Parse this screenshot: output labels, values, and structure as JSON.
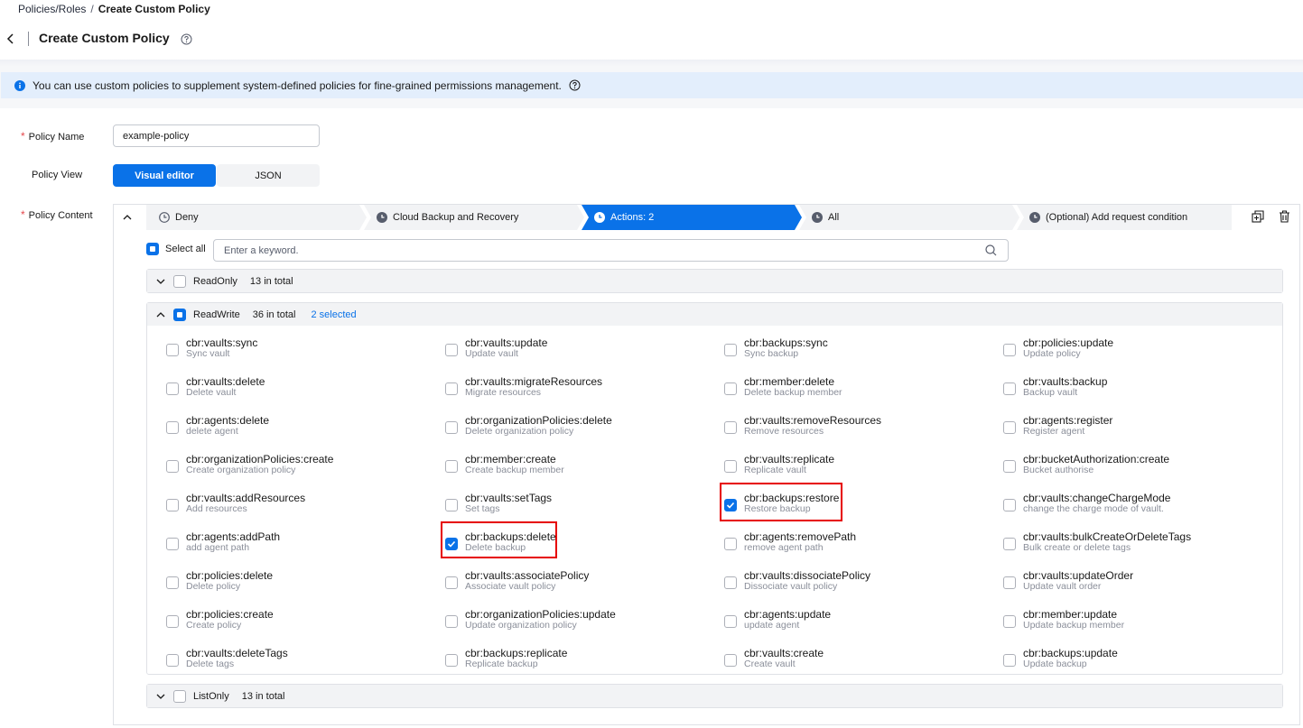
{
  "breadcrumb": {
    "parent": "Policies/Roles",
    "separator": "/",
    "current": "Create Custom Policy"
  },
  "page": {
    "title": "Create Custom Policy"
  },
  "info": {
    "text": "You can use custom policies to supplement system-defined policies for fine-grained permissions management."
  },
  "form": {
    "name_label": "Policy Name",
    "name_value": "example-policy",
    "view_label": "Policy View",
    "view_options": [
      "Visual editor",
      "JSON"
    ],
    "content_label": "Policy Content"
  },
  "steps": [
    "Deny",
    "Cloud Backup and Recovery",
    "Actions: 2",
    "All",
    "(Optional) Add request condition"
  ],
  "select_all_label": "Select all",
  "search_placeholder": "Enter a keyword.",
  "groups": {
    "readonly": {
      "name": "ReadOnly",
      "count": "13 in total"
    },
    "readwrite": {
      "name": "ReadWrite",
      "count": "36 in total",
      "selected": "2 selected"
    },
    "listonly": {
      "name": "ListOnly",
      "count": "13 in total"
    }
  },
  "actions": [
    [
      {
        "name": "cbr:vaults:sync",
        "desc": "Sync vault",
        "checked": false
      },
      {
        "name": "cbr:vaults:update",
        "desc": "Update vault",
        "checked": false
      },
      {
        "name": "cbr:backups:sync",
        "desc": "Sync backup",
        "checked": false
      },
      {
        "name": "cbr:policies:update",
        "desc": "Update policy",
        "checked": false
      }
    ],
    [
      {
        "name": "cbr:vaults:delete",
        "desc": "Delete vault",
        "checked": false
      },
      {
        "name": "cbr:vaults:migrateResources",
        "desc": "Migrate resources",
        "checked": false
      },
      {
        "name": "cbr:member:delete",
        "desc": "Delete backup member",
        "checked": false
      },
      {
        "name": "cbr:vaults:backup",
        "desc": "Backup vault",
        "checked": false
      }
    ],
    [
      {
        "name": "cbr:agents:delete",
        "desc": "delete agent",
        "checked": false
      },
      {
        "name": "cbr:organizationPolicies:delete",
        "desc": "Delete organization policy",
        "checked": false
      },
      {
        "name": "cbr:vaults:removeResources",
        "desc": "Remove resources",
        "checked": false
      },
      {
        "name": "cbr:agents:register",
        "desc": "Register agent",
        "checked": false
      }
    ],
    [
      {
        "name": "cbr:organizationPolicies:create",
        "desc": "Create organization policy",
        "checked": false
      },
      {
        "name": "cbr:member:create",
        "desc": "Create backup member",
        "checked": false
      },
      {
        "name": "cbr:vaults:replicate",
        "desc": "Replicate vault",
        "checked": false
      },
      {
        "name": "cbr:bucketAuthorization:create",
        "desc": "Bucket authorise",
        "checked": false
      }
    ],
    [
      {
        "name": "cbr:vaults:addResources",
        "desc": "Add resources",
        "checked": false
      },
      {
        "name": "cbr:vaults:setTags",
        "desc": "Set tags",
        "checked": false
      },
      {
        "name": "cbr:backups:restore",
        "desc": "Restore backup",
        "checked": true
      },
      {
        "name": "cbr:vaults:changeChargeMode",
        "desc": "change the charge mode of vault.",
        "checked": false
      }
    ],
    [
      {
        "name": "cbr:agents:addPath",
        "desc": "add agent path",
        "checked": false
      },
      {
        "name": "cbr:backups:delete",
        "desc": "Delete backup",
        "checked": true
      },
      {
        "name": "cbr:agents:removePath",
        "desc": "remove agent path",
        "checked": false
      },
      {
        "name": "cbr:vaults:bulkCreateOrDeleteTags",
        "desc": "Bulk create or delete tags",
        "checked": false
      }
    ],
    [
      {
        "name": "cbr:policies:delete",
        "desc": "Delete policy",
        "checked": false
      },
      {
        "name": "cbr:vaults:associatePolicy",
        "desc": "Associate vault policy",
        "checked": false
      },
      {
        "name": "cbr:vaults:dissociatePolicy",
        "desc": "Dissociate vault policy",
        "checked": false
      },
      {
        "name": "cbr:vaults:updateOrder",
        "desc": "Update vault order",
        "checked": false
      }
    ],
    [
      {
        "name": "cbr:policies:create",
        "desc": "Create policy",
        "checked": false
      },
      {
        "name": "cbr:organizationPolicies:update",
        "desc": "Update organization policy",
        "checked": false
      },
      {
        "name": "cbr:agents:update",
        "desc": "update agent",
        "checked": false
      },
      {
        "name": "cbr:member:update",
        "desc": "Update backup member",
        "checked": false
      }
    ],
    [
      {
        "name": "cbr:vaults:deleteTags",
        "desc": "Delete tags",
        "checked": false
      },
      {
        "name": "cbr:backups:replicate",
        "desc": "Replicate backup",
        "checked": false
      },
      {
        "name": "cbr:vaults:create",
        "desc": "Create vault",
        "checked": false
      },
      {
        "name": "cbr:backups:update",
        "desc": "Update backup",
        "checked": false
      }
    ]
  ],
  "colors": {
    "primary": "#0a72e8",
    "highlight": "#e60000",
    "info_bg": "#e3eefc"
  }
}
